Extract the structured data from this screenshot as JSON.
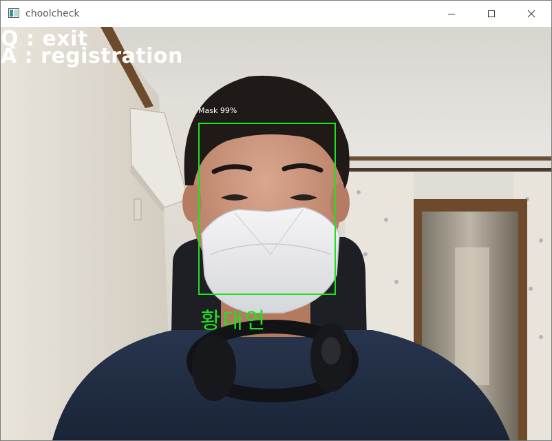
{
  "window": {
    "title": "choolcheck",
    "minimize_label": "Minimize",
    "maximize_label": "Maximize",
    "close_label": "Close"
  },
  "overlay": {
    "exit_hint": "Q : exit",
    "registration_hint": "A : registration"
  },
  "detection": {
    "label": "Mask 99%",
    "person_name": "황대연",
    "box_color": "#20e020"
  },
  "colors": {
    "overlay_text": "#ffffff",
    "name_text": "#20e020",
    "title_text": "#5a5a5a"
  },
  "icons": {
    "app": "opencv-window-icon",
    "minimize": "minimize-icon",
    "maximize": "maximize-icon",
    "close": "close-icon"
  }
}
